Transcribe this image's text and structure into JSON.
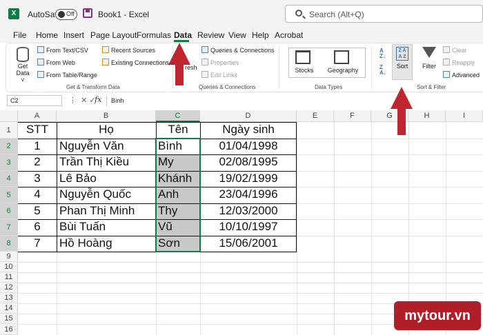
{
  "titlebar": {
    "logo": "X",
    "autosave_label": "AutoSave",
    "autosave_state": "Off",
    "book_title": "Book1  -  Excel",
    "search_placeholder": "Search (Alt+Q)"
  },
  "menu": {
    "tabs": [
      "File",
      "Home",
      "Insert",
      "Page Layout",
      "Formulas",
      "Data",
      "Review",
      "View",
      "Help",
      "Acrobat"
    ],
    "active_tab": "Data"
  },
  "ribbon": {
    "get_data": {
      "label_line1": "Get",
      "label_line2": "Data ˅"
    },
    "get_transform": {
      "items": [
        "From Text/CSV",
        "From Web",
        "From Table/Range",
        "Recent Sources",
        "Existing Connections"
      ],
      "group_label": "Get & Transform Data"
    },
    "queries": {
      "refresh_label": "resh",
      "items": [
        "Queries & Connections",
        "Properties",
        "Edit Links"
      ],
      "group_label": "Queries & Connections"
    },
    "data_types": {
      "stocks": "Stocks",
      "geography": "Geography",
      "group_label": "Data Types"
    },
    "sort_filter": {
      "sort": "Sort",
      "filter": "Filter",
      "clear": "Clear",
      "reapply": "Reapply",
      "advanced": "Advanced",
      "group_label": "Sort & Filter"
    }
  },
  "formula_bar": {
    "name_box": "C2",
    "fx": "fx",
    "value": "Bình"
  },
  "grid": {
    "columns": [
      "A",
      "B",
      "C",
      "D",
      "E",
      "F",
      "G",
      "H",
      "I"
    ],
    "selected_column": "C",
    "row_numbers": [
      "1",
      "2",
      "3",
      "4",
      "5",
      "6",
      "7",
      "8",
      "9",
      "10",
      "11",
      "12",
      "13",
      "14",
      "15",
      "16"
    ],
    "table": {
      "headers": [
        "STT",
        "Họ",
        "Tên",
        "Ngày sinh"
      ],
      "rows": [
        [
          "1",
          "Nguyễn Văn",
          "Bình",
          "01/04/1998"
        ],
        [
          "2",
          "Trần Thị Kiều",
          "My",
          "02/08/1995"
        ],
        [
          "3",
          "Lê Bảo",
          "Khánh",
          "19/02/1999"
        ],
        [
          "4",
          "Nguyễn Quốc",
          "Anh",
          "23/04/1996"
        ],
        [
          "5",
          "Phan Thị Minh",
          "Thy",
          "12/03/2000"
        ],
        [
          "6",
          "Bùi Tuấn",
          "Vũ",
          "10/10/1997"
        ],
        [
          "7",
          "Hồ Hoàng",
          "Sơn",
          "15/06/2001"
        ]
      ]
    }
  },
  "colors": {
    "accent": "#107c41",
    "arrow": "#c0262d",
    "watermark": "#b01e27"
  },
  "watermark": "mytour.vn"
}
